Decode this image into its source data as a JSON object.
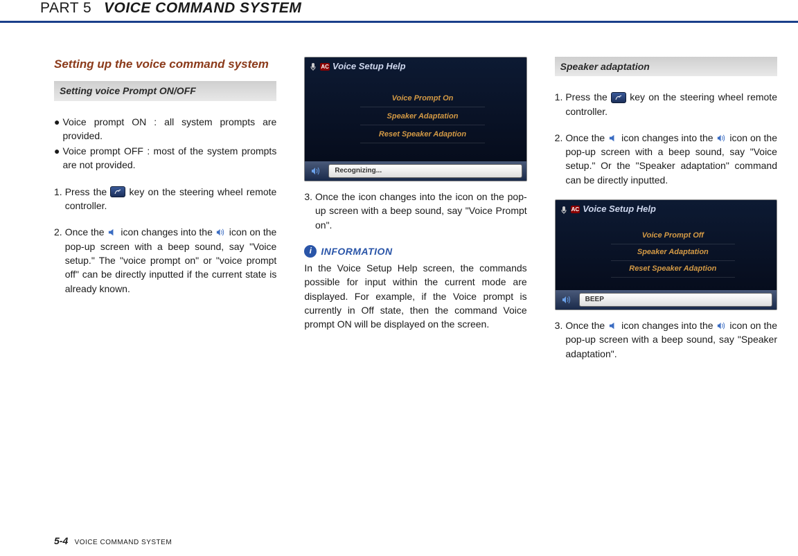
{
  "header": {
    "part_label": "PART 5",
    "part_title": "VOICE COMMAND SYSTEM"
  },
  "col1": {
    "section_title": "Setting up the voice command system",
    "subheader": "Setting voice Prompt ON/OFF",
    "bullets": [
      "Voice prompt ON : all system prompts are provided.",
      "Voice prompt OFF : most of the system prompts are not provided."
    ],
    "step1_pre": "Press the ",
    "step1_post": " key on the steering wheel remote controller.",
    "step2_a": "Once the ",
    "step2_b": " icon changes into the ",
    "step2_c": " icon on the pop-up screen with a beep sound, say \"Voice setup.\" The \"voice prompt on\" or \"voice prompt off\" can be directly inputted if the current state is already known."
  },
  "col2": {
    "ss1": {
      "title": "Voice Setup Help",
      "items": [
        "Voice Prompt On",
        "Speaker Adaptation",
        "Reset Speaker Adaption"
      ],
      "status": "Recognizing..."
    },
    "step3": "Once the  icon changes into the icon on the pop-up screen with a beep sound, say \"Voice Prompt on\".",
    "info_label": "INFORMATION",
    "info_body": "In the Voice Setup Help screen, the commands possible for input within the current mode are displayed. For example, if the Voice prompt is currently in Off state, then the command Voice prompt ON will be displayed on the screen."
  },
  "col3": {
    "subheader": "Speaker adaptation",
    "step1_pre": "Press the ",
    "step1_post": " key on the steering wheel remote controller.",
    "step2_a": "Once the ",
    "step2_b": " icon changes into the ",
    "step2_c": " icon on the pop-up screen with a beep sound, say \"Voice setup.\" Or the \"Speaker adaptation\" command can be directly inputted.",
    "ss2": {
      "title": "Voice Setup Help",
      "items": [
        "Voice Prompt Off",
        "Speaker Adaptation",
        "Reset Speaker Adaption"
      ],
      "status": "BEEP"
    },
    "step3_a": "Once the ",
    "step3_b": " icon changes into the ",
    "step3_c": " icon on the pop-up screen with a beep sound, say \"Speaker adaptation\"."
  },
  "footer": {
    "page_number": "5-4",
    "title": "VOICE COMMAND SYSTEM"
  }
}
